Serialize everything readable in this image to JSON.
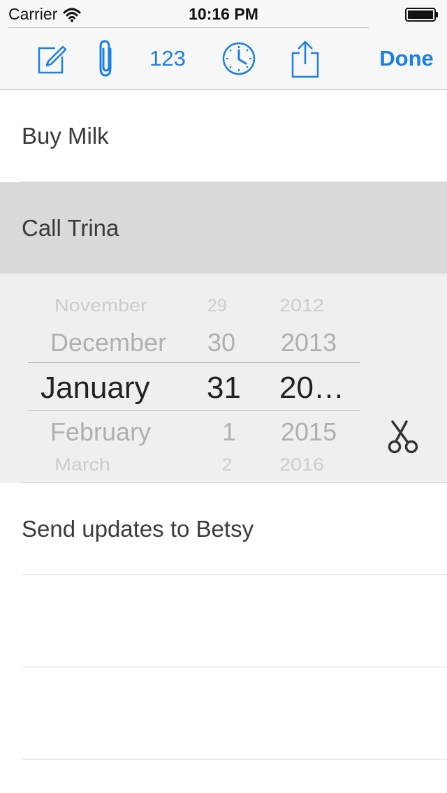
{
  "status_bar": {
    "carrier": "Carrier",
    "time": "10:16 PM"
  },
  "toolbar": {
    "compose_icon": "compose-icon",
    "attach_icon": "paperclip-icon",
    "number_label": "123",
    "clock_icon": "clock-icon",
    "share_icon": "share-icon",
    "done_label": "Done",
    "accent_color": "#1a7fe8"
  },
  "tasks": [
    {
      "label": "Buy Milk"
    },
    {
      "label": "Call Trina",
      "selected": true
    },
    {
      "label": "Send updates to Betsy"
    },
    {
      "label": ""
    },
    {
      "label": ""
    }
  ],
  "date_picker": {
    "months": [
      "November",
      "December",
      "January",
      "February",
      "March"
    ],
    "days": [
      "29",
      "30",
      "31",
      "1",
      "2"
    ],
    "years": [
      "2012",
      "2013",
      "20…",
      "2015",
      "2016"
    ],
    "selected_index": 2,
    "cut_icon": "scissors-icon"
  }
}
